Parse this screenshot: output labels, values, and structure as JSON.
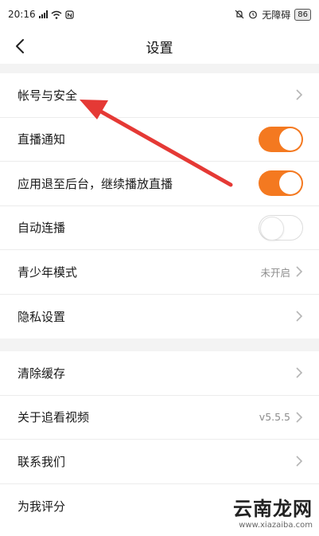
{
  "status_bar": {
    "time": "20:16",
    "net_speed_label": "无障碍",
    "battery": "86"
  },
  "header": {
    "back_icon": "chevron-left-icon",
    "title": "设置"
  },
  "group1": [
    {
      "label": "帐号与安全",
      "type": "link"
    },
    {
      "label": "直播通知",
      "type": "toggle",
      "on": true
    },
    {
      "label": "应用退至后台，继续播放直播",
      "type": "toggle",
      "on": true
    },
    {
      "label": "自动连播",
      "type": "toggle",
      "on": false
    },
    {
      "label": "青少年模式",
      "type": "link",
      "value": "未开启"
    },
    {
      "label": "隐私设置",
      "type": "link"
    }
  ],
  "group2": [
    {
      "label": "清除缓存",
      "type": "link"
    },
    {
      "label": "关于追看视频",
      "type": "link",
      "value": "v5.5.5"
    },
    {
      "label": "联系我们",
      "type": "link"
    },
    {
      "label": "为我评分",
      "type": "link"
    }
  ],
  "annotation": {
    "color": "#e53935"
  },
  "watermark": {
    "main": "云南龙网",
    "sub": "www.xiazaiba.com"
  },
  "colors": {
    "accent": "#f47920",
    "background_gap": "#f3f3f3"
  }
}
